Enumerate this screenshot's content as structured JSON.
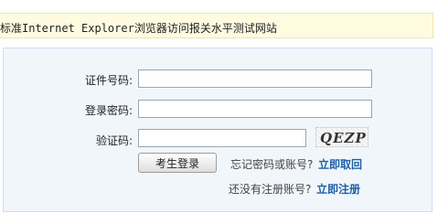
{
  "notice": {
    "text": "标准Internet Explorer浏览器访问报关水平测试网站"
  },
  "form": {
    "id_label": "证件号码:",
    "id_value": "",
    "password_label": "登录密码:",
    "password_value": "",
    "captcha_label": "验证码:",
    "captcha_value": "",
    "captcha_image_text": "QEZP",
    "login_button": "考生登录",
    "forgot_text": "忘记密码或账号?",
    "forgot_link": "立即取回",
    "register_text": "还没有注册账号?",
    "register_link": "立即注册"
  },
  "colors": {
    "notice_bg": "#fffbe1",
    "panel_bg": "#f1f6fb",
    "link": "#1f5fa8"
  }
}
